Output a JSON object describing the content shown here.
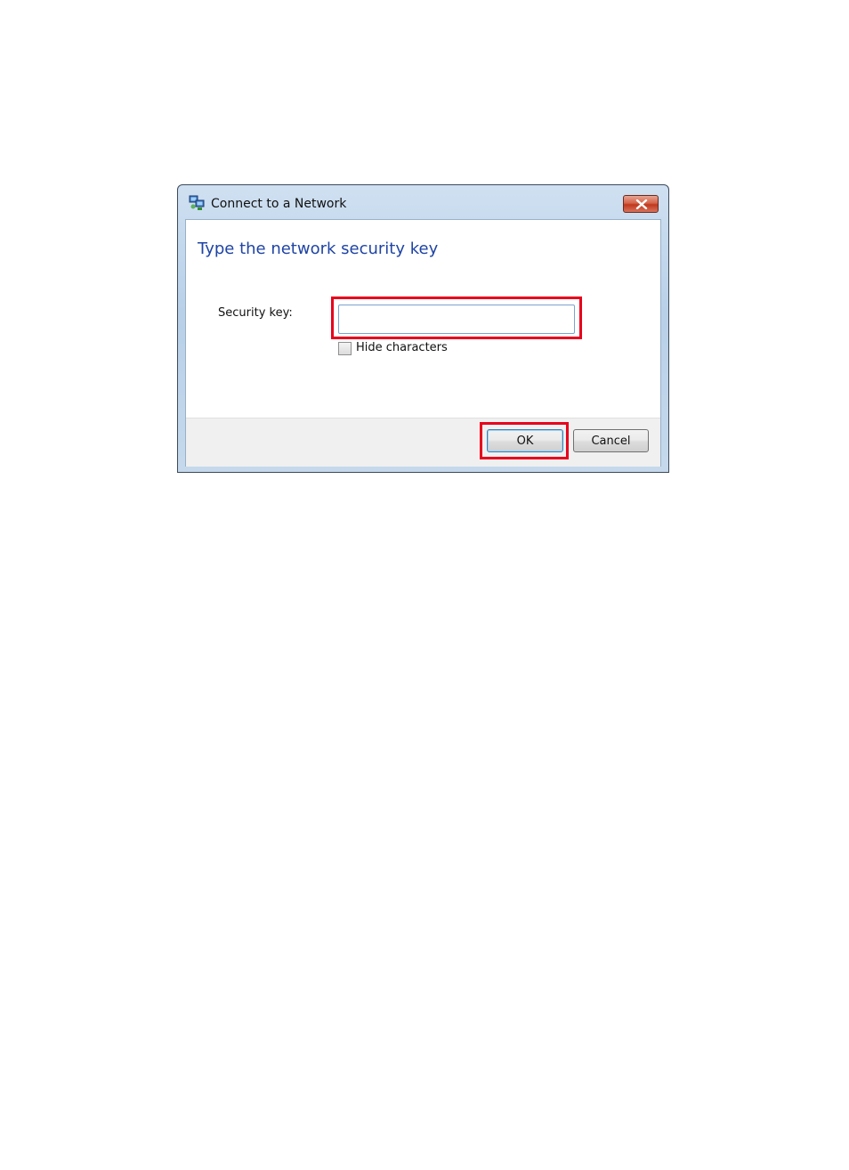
{
  "window": {
    "title": "Connect to a Network",
    "icon": "network-connect-icon",
    "close_icon": "close-icon"
  },
  "main": {
    "heading": "Type the network security key",
    "security_key_label": "Security key:",
    "security_key_value": "",
    "hide_characters_label": "Hide characters",
    "hide_characters_checked": false
  },
  "footer": {
    "ok_label": "OK",
    "cancel_label": "Cancel"
  },
  "colors": {
    "heading": "#1f44a4",
    "highlight": "#e8001c",
    "close_button": "#c0381d"
  }
}
